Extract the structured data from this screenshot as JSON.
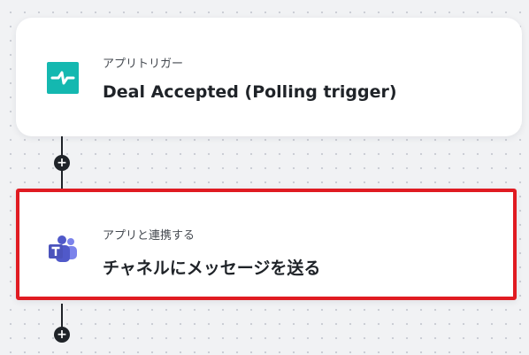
{
  "colors": {
    "canvas": "#f1f2f4",
    "accent_selected": "#e01b22",
    "connector": "#1f2328",
    "trigger_icon": "#14b8b0",
    "teams_icon": "#5059c9"
  },
  "flow": {
    "trigger_step": {
      "subtitle": "アプリトリガー",
      "title": "Deal Accepted (Polling trigger)",
      "icon": "app-trigger-icon"
    },
    "action_step": {
      "subtitle": "アプリと連携する",
      "title": "チャネルにメッセージを送る",
      "icon": "microsoft-teams-icon",
      "selected": true
    },
    "add_step_symbol": "+"
  }
}
